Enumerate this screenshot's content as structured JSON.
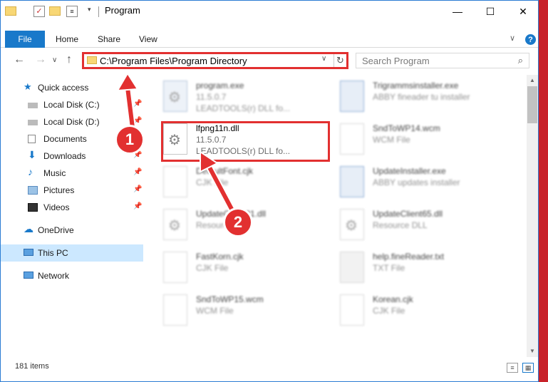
{
  "window": {
    "title": "Program"
  },
  "titlebar": {
    "minimize": "—",
    "maximize": "☐",
    "close": "✕"
  },
  "ribbon": {
    "file": "File",
    "home": "Home",
    "share": "Share",
    "view": "View",
    "expand": "∨",
    "help": "?"
  },
  "nav": {
    "back": "←",
    "forward": "→",
    "dropdown": "∨",
    "up": "↑"
  },
  "address": {
    "path": "C:\\Program Files\\Program Directory",
    "dropdown": "∨",
    "refresh": "↻"
  },
  "search": {
    "placeholder": "Search Program",
    "icon": "⌕"
  },
  "sidebar": {
    "items": [
      {
        "label": "Quick access",
        "icon": "star-icon"
      },
      {
        "label": "Local Disk (C:)",
        "icon": "drive-icon"
      },
      {
        "label": "Local Disk (D:)",
        "icon": "drive-icon"
      },
      {
        "label": "Documents",
        "icon": "documents-icon"
      },
      {
        "label": "Downloads",
        "icon": "downloads-icon"
      },
      {
        "label": "Music",
        "icon": "music-icon"
      },
      {
        "label": "Pictures",
        "icon": "pictures-icon"
      },
      {
        "label": "Videos",
        "icon": "videos-icon"
      },
      {
        "label": "OneDrive",
        "icon": "cloud-icon"
      },
      {
        "label": "This PC",
        "icon": "pc-icon"
      },
      {
        "label": "Network",
        "icon": "network-icon"
      }
    ],
    "pin": "📌"
  },
  "files": [
    {
      "name": "program.exe",
      "line2": "11.5.0.7",
      "line3": "LEADTOOLS(r) DLL fo..."
    },
    {
      "name": "Trigrammsinstaller.exe",
      "line2": "ABBY fineader tu installer",
      "line3": ""
    },
    {
      "name": "lfpng11n.dll",
      "line2": "11.5.0.7",
      "line3": "LEADTOOLS(r) DLL fo..."
    },
    {
      "name": "SndToWP14.wcm",
      "line2": "WCM File",
      "line3": ""
    },
    {
      "name": "DefaultFont.cjk",
      "line2": "CJK File",
      "line3": ""
    },
    {
      "name": "UpdateInstaller.exe",
      "line2": "ABBY updates installer",
      "line3": ""
    },
    {
      "name": "UpdateClient21.dll",
      "line2": "Resource DLL",
      "line3": ""
    },
    {
      "name": "UpdateClient65.dll",
      "line2": "Resource DLL",
      "line3": ""
    },
    {
      "name": "FastKorn.cjk",
      "line2": "CJK File",
      "line3": ""
    },
    {
      "name": "help.fineReader.txt",
      "line2": "TXT File",
      "line3": ""
    },
    {
      "name": "SndToWP15.wcm",
      "line2": "WCM File",
      "line3": ""
    },
    {
      "name": "Korean.cjk",
      "line2": "CJK File",
      "line3": ""
    }
  ],
  "scroll": {
    "up": "▲",
    "down": "▼"
  },
  "status": {
    "items": "181 items",
    "details_view": "≡",
    "icons_view": "▦"
  },
  "annotations": {
    "step1": "1",
    "step2": "2",
    "color": "#e23030"
  }
}
